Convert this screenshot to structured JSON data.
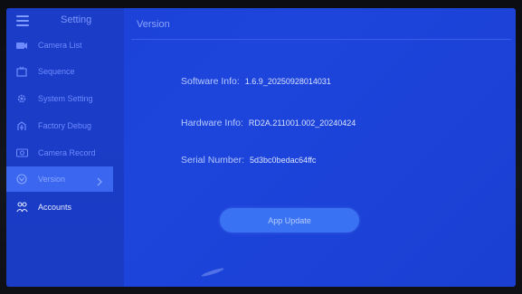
{
  "header": {
    "menu_icon": "hamburger-icon",
    "setting_title": "Setting",
    "page_title": "Version"
  },
  "sidebar": {
    "items": [
      {
        "label": "Camera List",
        "icon": "camera-icon"
      },
      {
        "label": "Sequence",
        "icon": "sequence-icon"
      },
      {
        "label": "System Setting",
        "icon": "gear-icon"
      },
      {
        "label": "Factory Debug",
        "icon": "debug-icon"
      },
      {
        "label": "Camera Record",
        "icon": "record-icon"
      },
      {
        "label": "Version",
        "icon": "version-icon",
        "active": true
      },
      {
        "label": "Accounts",
        "icon": "accounts-icon"
      }
    ]
  },
  "info": {
    "software_label": "Software Info:",
    "software_value": "1.6.9_20250928014031",
    "hardware_label": "Hardware Info:",
    "hardware_value": "RD2A.211001.002_20240424",
    "serial_label": "Serial Number:",
    "serial_value": "5d3bc0bedac64ffc"
  },
  "actions": {
    "app_update_label": "App Update"
  },
  "colors": {
    "background": "#1b40d6",
    "active_item": "#3a66f0",
    "button": "#3a72f4"
  }
}
